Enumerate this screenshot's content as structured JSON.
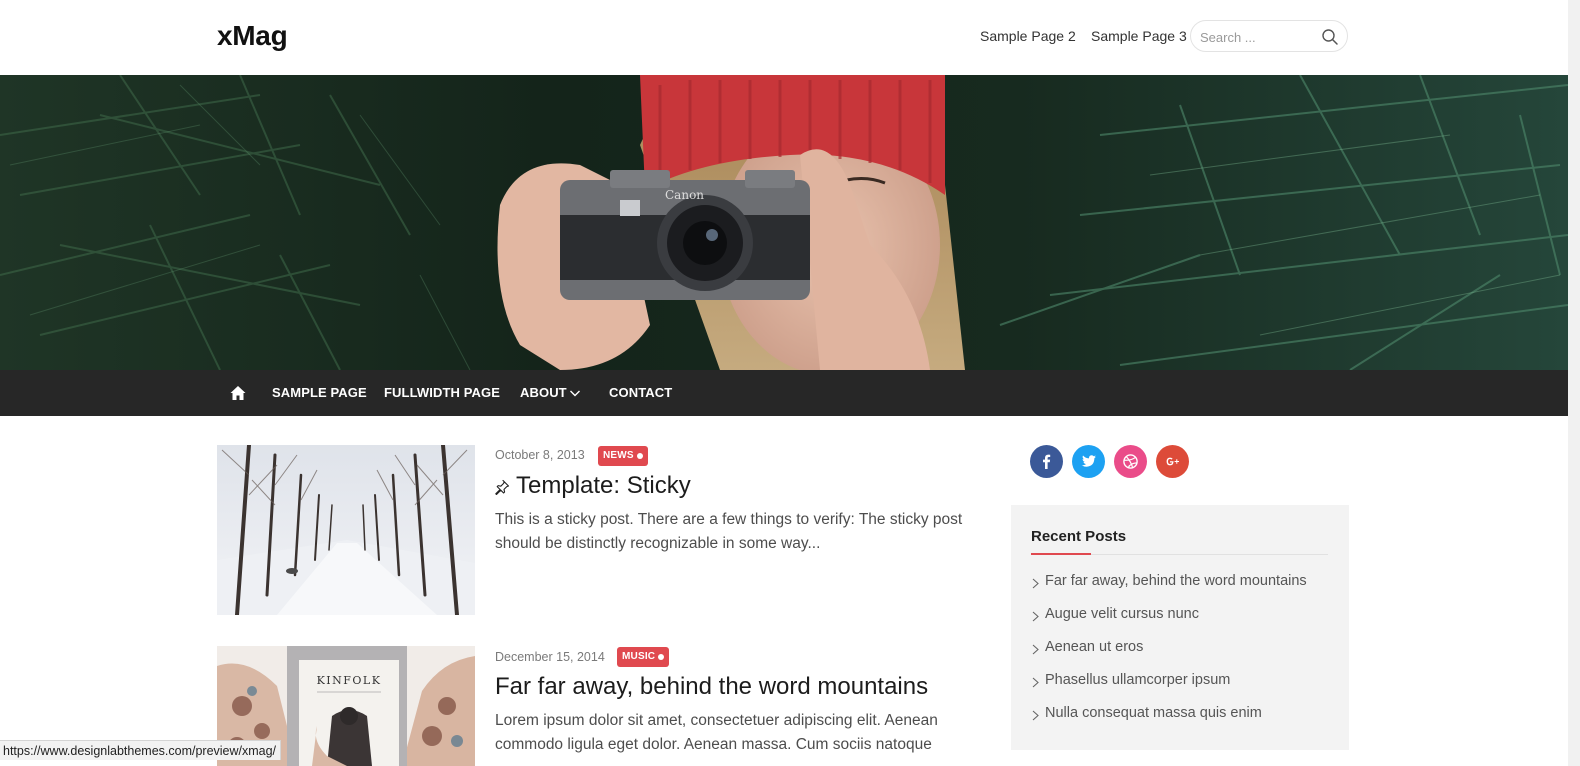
{
  "header": {
    "site_title": "xMag",
    "top_links": [
      "Sample Page 2",
      "Sample Page 3"
    ],
    "search_placeholder": "Search ..."
  },
  "nav": {
    "home_icon": "home-icon",
    "items": [
      "SAMPLE PAGE",
      "FULLWIDTH PAGE",
      "ABOUT",
      "CONTACT"
    ]
  },
  "posts": [
    {
      "date": "October 8, 2013",
      "category": "NEWS",
      "title": "Template: Sticky",
      "sticky": true,
      "excerpt": "This is a sticky post. There are a few things to verify: The sticky post should be distinctly recognizable in some way..."
    },
    {
      "date": "December 15, 2014",
      "category": "MUSIC",
      "title": "Far far away, behind the word mountains",
      "excerpt": "Lorem ipsum dolor sit amet, consectetuer adipiscing elit. Aenean commodo ligula eget dolor. Aenean massa. Cum sociis natoque",
      "thumb_text": "KINFOLK"
    }
  ],
  "sidebar": {
    "social": [
      "facebook-icon",
      "twitter-icon",
      "dribbble-icon",
      "google-plus-icon"
    ],
    "recent_posts": {
      "title": "Recent Posts",
      "items": [
        "Far far away, behind the word mountains",
        "Augue velit cursus nunc",
        "Aenean ut eros",
        "Phasellus ullamcorper ipsum",
        "Nulla consequat massa quis enim"
      ]
    }
  },
  "status_bar": {
    "url": "https://www.designlabthemes.com/preview/xmag/"
  },
  "colors": {
    "accent": "#e0494f",
    "nav_bg": "#272727",
    "facebook": "#3b5998",
    "twitter": "#1da1f2",
    "dribbble": "#ea4c89",
    "google_plus": "#dd4b39"
  }
}
